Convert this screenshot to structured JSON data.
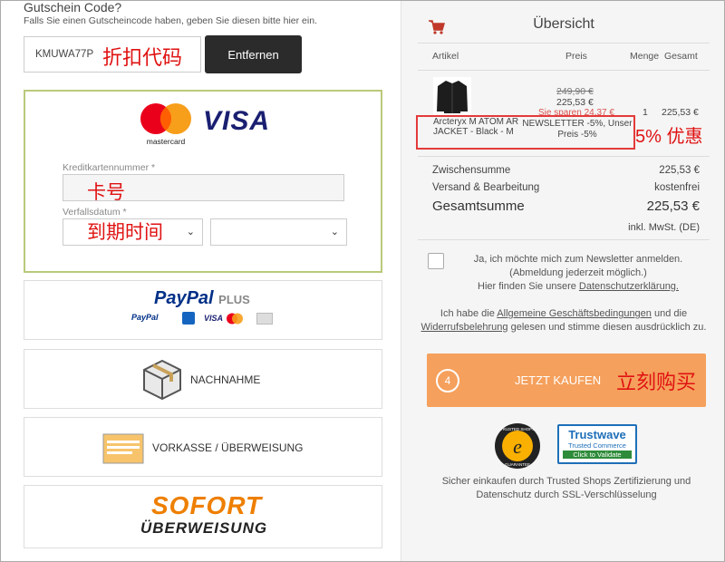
{
  "coupon": {
    "title": "Gutschein Code?",
    "hint": "Falls Sie einen Gutscheincode haben, geben Sie diesen bitte hier ein.",
    "code": "KMUWA77P",
    "annotation": "折扣代码",
    "remove_label": "Entfernen"
  },
  "card": {
    "mastercard_label": "mastercard",
    "visa_label": "VISA",
    "number_label": "Kreditkartennummer  *",
    "number_annotation": "卡号",
    "expiry_label": "Verfallsdatum  *",
    "expiry_annotation": "到期时间"
  },
  "payment_methods": {
    "paypal_main": "PayPal",
    "paypal_plus": "PLUS",
    "paypal_small": "PayPal",
    "visa_small": "VISA",
    "cod_label": "NACHNAHME",
    "prepay_label": "VORKASSE / ÜBERWEISUNG",
    "sofort_top": "SOFORT",
    "sofort_bottom": "ÜBERWEISUNG"
  },
  "summary": {
    "title": "Übersicht",
    "headers": {
      "article": "Artikel",
      "price": "Preis",
      "qty": "Menge",
      "total": "Gesamt"
    },
    "item": {
      "old_price": "249,90 €",
      "price": "225,53 €",
      "savings": "Sie sparen 24,37 €",
      "qty": "1",
      "total": "225,53 €",
      "name": "Arcteryx M ATOM AR JACKET - Black - M",
      "discount_note": "NEWSLETTER -5%, Unser Preis -5%",
      "annotation": "5% 优惠"
    },
    "subtotal_label": "Zwischensumme",
    "subtotal_value": "225,53 €",
    "shipping_label": "Versand & Bearbeitung",
    "shipping_value": "kostenfrei",
    "total_label": "Gesamtsumme",
    "total_value": "225,53 €",
    "tax_note": "inkl. MwSt. (DE)"
  },
  "newsletter": {
    "line1": "Ja, ich möchte mich zum Newsletter anmelden.",
    "line2": "(Abmeldung jederzeit möglich.)",
    "line3": "Hier finden Sie unsere",
    "privacy_link": "Datenschutzerklärung."
  },
  "terms": {
    "prefix": "Ich habe die",
    "agb_link": "Allgemeine Geschäftsbedingungen",
    "middle": "und die",
    "withdrawal_link": "Widerrufsbelehrung",
    "suffix": "gelesen und stimme diesen ausdrücklich zu."
  },
  "buy": {
    "step": "4",
    "label": "JETZT KAUFEN",
    "annotation": "立刻购买"
  },
  "trust": {
    "ts_label": "TRUSTED SHOPS",
    "ts_sub": "GUARANTEE",
    "tw_title": "Trustwave",
    "tw_sub": "Trusted Commerce",
    "tw_validate": "Click to Validate",
    "text": "Sicher einkaufen durch Trusted Shops Zertifizierung und Datenschutz durch SSL-Verschlüsselung"
  }
}
